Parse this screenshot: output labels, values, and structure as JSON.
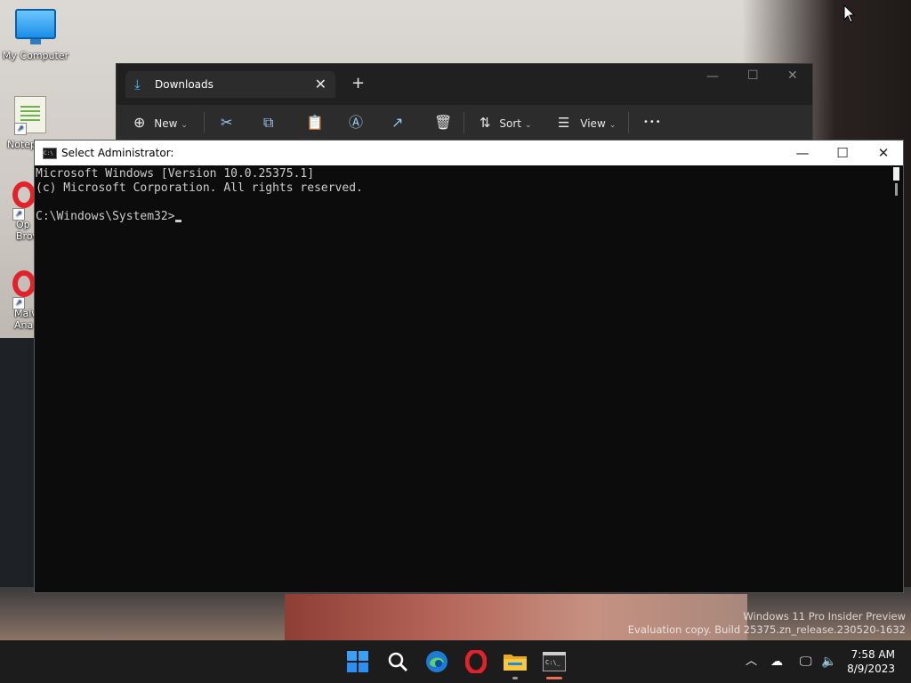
{
  "desktop": {
    "icons": [
      {
        "label": "My Computer"
      },
      {
        "label": "Notep"
      },
      {
        "label": "Op\nBrov"
      },
      {
        "label": "Malv\nAna"
      }
    ],
    "watermark": {
      "line1": "Windows 11 Pro Insider Preview",
      "line2": "Evaluation copy. Build 25375.zn_release.230520-1632"
    }
  },
  "explorer": {
    "tab_title": "Downloads",
    "toolbar": {
      "new_label": "New",
      "sort_label": "Sort",
      "view_label": "View",
      "more_label": "•••"
    }
  },
  "cmd": {
    "title": "Select Administrator:",
    "lines": [
      "Microsoft Windows [Version 10.0.25375.1]",
      "(c) Microsoft Corporation. All rights reserved.",
      "",
      "C:\\Windows\\System32>"
    ]
  },
  "taskbar": {
    "apps": [
      "start-icon",
      "search-icon",
      "edge-icon",
      "opera-icon",
      "file-explorer-icon",
      "terminal-icon"
    ],
    "clock_time": "7:58 AM",
    "clock_date": "8/9/2023"
  },
  "colors": {
    "taskbar_bg": "#1c1c1c",
    "cmd_bg": "#0c0c0c",
    "accent": "#4cc2ff"
  }
}
